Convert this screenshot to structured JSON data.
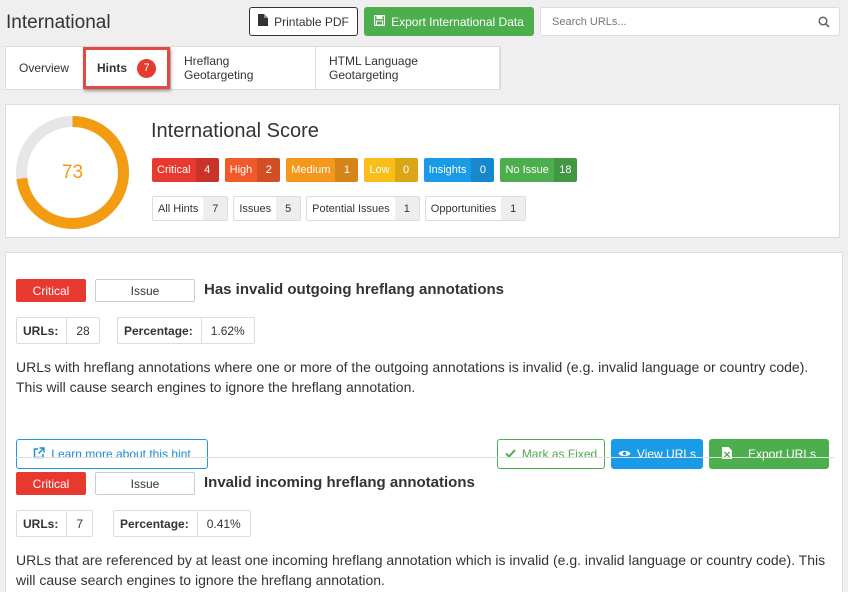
{
  "header": {
    "title": "International",
    "pdf_label": "Printable PDF",
    "export_label": "Export International Data",
    "search_placeholder": "Search URLs..."
  },
  "tabs": [
    {
      "label": "Overview"
    },
    {
      "label": "Hints",
      "count": "7"
    },
    {
      "label": "Hreflang Geotargeting"
    },
    {
      "label": "HTML Language Geotargeting"
    }
  ],
  "score": {
    "title": "International Score",
    "value": "73",
    "percent": 73,
    "colors": {
      "arc": "#f39c12",
      "track": "#e6e6e6"
    },
    "severity": [
      {
        "label": "Critical",
        "count": "4",
        "color": "#e8392f"
      },
      {
        "label": "High",
        "count": "2",
        "color": "#f0592a"
      },
      {
        "label": "Medium",
        "count": "1",
        "color": "#f3981b"
      },
      {
        "label": "Low",
        "count": "0",
        "color": "#f9be1a"
      },
      {
        "label": "Insights",
        "count": "0",
        "color": "#1a9be8"
      },
      {
        "label": "No Issue",
        "count": "18",
        "color": "#4cae4c"
      }
    ],
    "types": [
      {
        "label": "All Hints",
        "count": "7"
      },
      {
        "label": "Issues",
        "count": "5"
      },
      {
        "label": "Potential Issues",
        "count": "1"
      },
      {
        "label": "Opportunities",
        "count": "1"
      }
    ]
  },
  "hints": [
    {
      "severity": "Critical",
      "type": "Issue",
      "title": "Has invalid outgoing hreflang annotations",
      "urls_label": "URLs:",
      "urls": "28",
      "pct_label": "Percentage:",
      "pct": "1.62%",
      "description": "URLs with hreflang annotations where one or more of the outgoing annotations is invalid (e.g. invalid language or country code). This will cause search engines to ignore the hreflang annotation.",
      "learn_label": "Learn more about this hint",
      "fixed_label": "Mark as Fixed",
      "view_label": "View URLs",
      "export_label": "Export URLs"
    },
    {
      "severity": "Critical",
      "type": "Issue",
      "title": "Invalid incoming hreflang annotations",
      "urls_label": "URLs:",
      "urls": "7",
      "pct_label": "Percentage:",
      "pct": "0.41%",
      "description": "URLs that are referenced by at least one incoming hreflang annotation which is invalid (e.g. invalid language or country code). This will cause search engines to ignore the hreflang annotation."
    }
  ]
}
